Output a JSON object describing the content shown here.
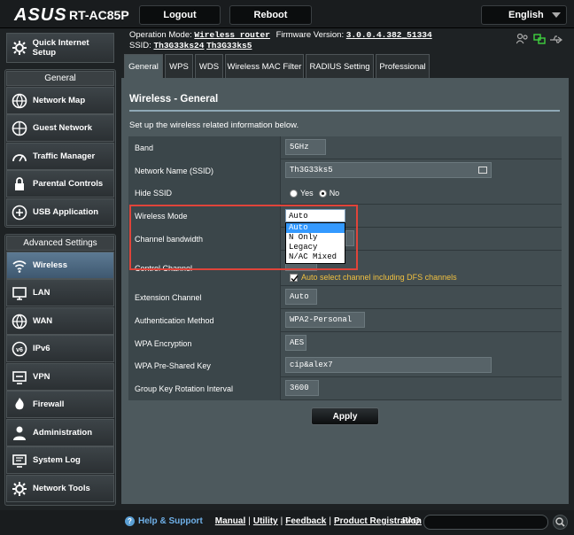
{
  "header": {
    "brand": "ASUS",
    "model": "RT-AC85P",
    "logout_label": "Logout",
    "reboot_label": "Reboot",
    "language": "English"
  },
  "info": {
    "op_mode_label": "Operation Mode:",
    "op_mode_value": "Wireless router",
    "fw_label": "Firmware Version:",
    "fw_value": "3.0.0.4.382_51334",
    "ssid_label": "SSID:",
    "ssid_1": "Th3G33ks24",
    "ssid_2": "Th3G33ks5"
  },
  "sidebar": {
    "quick_setup": "Quick Internet Setup",
    "general_header": "General",
    "general_items": [
      {
        "label": "Network Map",
        "icon": "network-map-icon"
      },
      {
        "label": "Guest Network",
        "icon": "guest-network-icon"
      },
      {
        "label": "Traffic Manager",
        "icon": "traffic-manager-icon"
      },
      {
        "label": "Parental Controls",
        "icon": "parental-controls-icon"
      },
      {
        "label": "USB Application",
        "icon": "usb-icon"
      }
    ],
    "advanced_header": "Advanced Settings",
    "advanced_items": [
      {
        "label": "Wireless",
        "icon": "wireless-icon"
      },
      {
        "label": "LAN",
        "icon": "lan-icon"
      },
      {
        "label": "WAN",
        "icon": "wan-icon"
      },
      {
        "label": "IPv6",
        "icon": "ipv6-icon"
      },
      {
        "label": "VPN",
        "icon": "vpn-icon"
      },
      {
        "label": "Firewall",
        "icon": "firewall-icon"
      },
      {
        "label": "Administration",
        "icon": "administration-icon"
      },
      {
        "label": "System Log",
        "icon": "system-log-icon"
      },
      {
        "label": "Network Tools",
        "icon": "network-tools-icon"
      }
    ]
  },
  "tabs": [
    "General",
    "WPS",
    "WDS",
    "Wireless MAC Filter",
    "RADIUS Setting",
    "Professional"
  ],
  "panel": {
    "title": "Wireless - General",
    "description": "Set up the wireless related information below."
  },
  "form": {
    "band_label": "Band",
    "band_value": "5GHz",
    "ssid_label": "Network Name (SSID)",
    "ssid_value": "Th3G33ks5",
    "hide_ssid_label": "Hide SSID",
    "hide_yes": "Yes",
    "hide_no": "No",
    "wireless_mode_label": "Wireless Mode",
    "wireless_mode_value": "Auto",
    "wireless_mode_options": [
      "Auto",
      "N Only",
      "Legacy",
      "N/AC Mixed"
    ],
    "channel_bw_label": "Channel bandwidth",
    "control_channel_label": "Control Channel",
    "dfs_label": "Auto select channel including DFS channels",
    "ext_channel_label": "Extension Channel",
    "ext_channel_value": "Auto",
    "auth_label": "Authentication Method",
    "auth_value": "WPA2-Personal",
    "wpa_enc_label": "WPA Encryption",
    "wpa_enc_value": "AES",
    "psk_label": "WPA Pre-Shared Key",
    "psk_value": "cip&alex7",
    "rotation_label": "Group Key Rotation Interval",
    "rotation_value": "3600"
  },
  "apply_label": "Apply",
  "footer": {
    "help": "Help & Support",
    "manual": "Manual",
    "utility": "Utility",
    "feedback": "Feedback",
    "registration": "Product Registration",
    "faq": "FAQ"
  },
  "colors": {
    "accent_dfs_text": "#f0c040",
    "highlight_border": "#e0443a",
    "panel_bg": "#4d595d"
  }
}
